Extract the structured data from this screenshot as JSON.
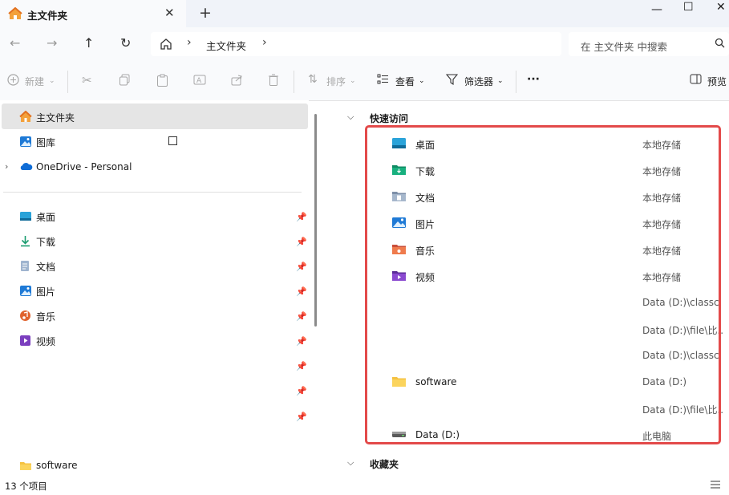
{
  "tab": {
    "title": "主文件夹",
    "close": "✕",
    "add": "+"
  },
  "window": {
    "minimize": "—",
    "maximize": "☐",
    "close": "✕"
  },
  "address": {
    "crumb": "主文件夹",
    "sep": "›"
  },
  "search": {
    "placeholder": "在 主文件夹 中搜索"
  },
  "toolbar": {
    "new_label": "新建",
    "sort_label": "排序",
    "view_label": "查看",
    "filter_label": "筛选器",
    "more": "···",
    "preview_label": "预览"
  },
  "nav": {
    "home": "主文件夹",
    "gallery": "图库",
    "onedrive": "OneDrive - Personal",
    "pinned": [
      "桌面",
      "下载",
      "文档",
      "图片",
      "音乐",
      "视频"
    ],
    "software": "software"
  },
  "content": {
    "quick_access_title": "快速访问",
    "favorites_title": "收藏夹",
    "rows": [
      {
        "name": "桌面",
        "location": "本地存储"
      },
      {
        "name": "下载",
        "location": "本地存储"
      },
      {
        "name": "文档",
        "location": "本地存储"
      },
      {
        "name": "图片",
        "location": "本地存储"
      },
      {
        "name": "音乐",
        "location": "本地存储"
      },
      {
        "name": "视频",
        "location": "本地存储"
      },
      {
        "name": "",
        "location": "Data (D:)\\classc..."
      },
      {
        "name": "",
        "location": "Data (D:)\\file\\比..."
      },
      {
        "name": "",
        "location": "Data (D:)\\classc..."
      },
      {
        "name": "software",
        "location": "Data (D:)"
      },
      {
        "name": "",
        "location": "Data (D:)\\file\\比..."
      },
      {
        "name": "Data (D:)",
        "location": "此电脑"
      }
    ]
  },
  "status": {
    "count": "13 个项目"
  },
  "colors": {
    "accent": "#0067c0",
    "highlight_border": "#e34a4a",
    "selected_bg": "#e5e5e5"
  }
}
